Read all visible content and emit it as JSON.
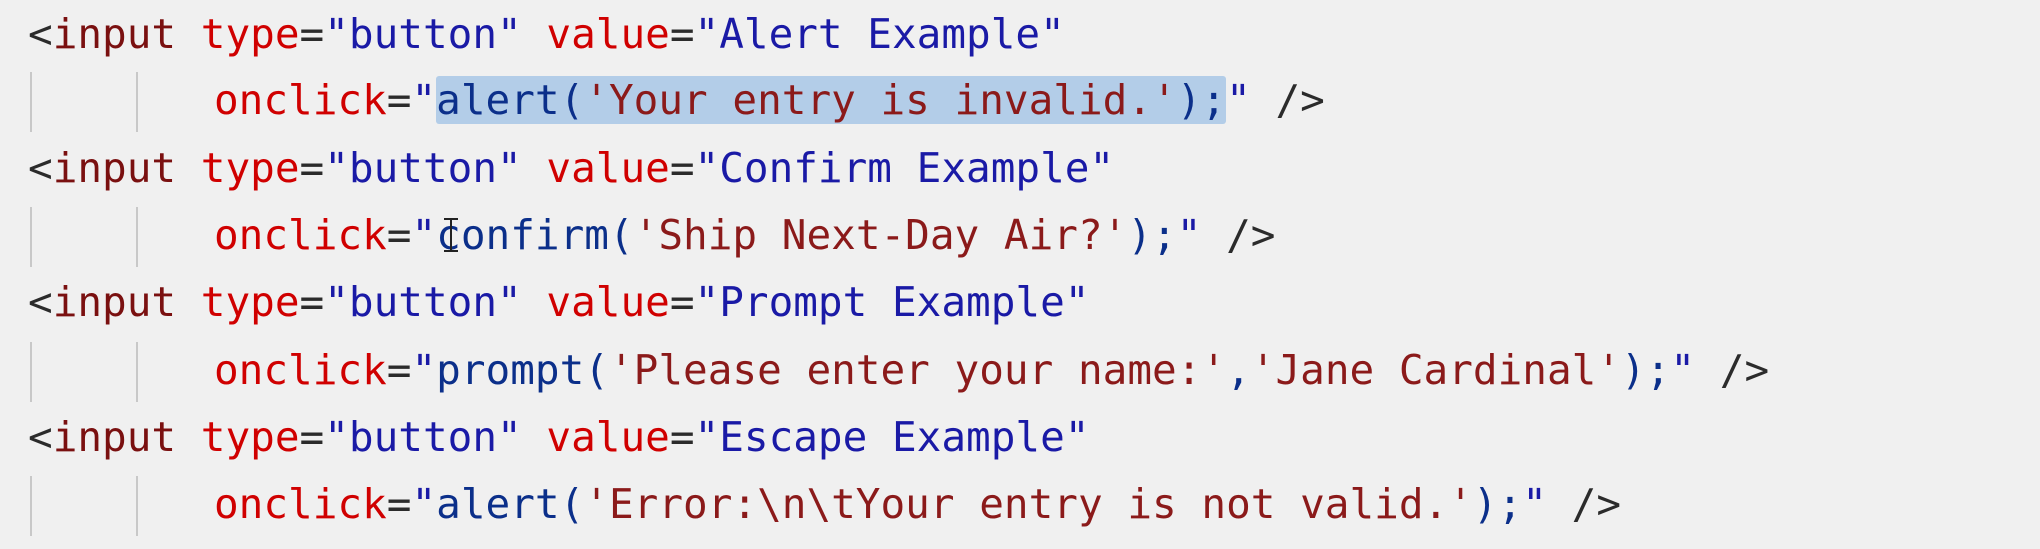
{
  "editor": {
    "lines": [
      {
        "open": "<",
        "tag": "input",
        "type_attr": "type",
        "eq1": "=",
        "type_val": "\"button\"",
        "value_attr": "value",
        "eq2": "=",
        "value_val": "\"Alert Example\""
      },
      {
        "onclick_attr": "onclick",
        "eq": "=",
        "quote_open": "\"",
        "js_fn": "alert(",
        "js_str": "'Your entry is invalid.'",
        "js_end": ");",
        "quote_close": "\"",
        "close": " />"
      },
      {
        "open": "<",
        "tag": "input",
        "type_attr": "type",
        "eq1": "=",
        "type_val": "\"button\"",
        "value_attr": "value",
        "eq2": "=",
        "value_val": "\"Confirm Example\""
      },
      {
        "onclick_attr": "onclick",
        "eq": "=",
        "quote_open": "\"",
        "js_fn": "confirm(",
        "js_str": "'Ship Next-Day Air?'",
        "js_end": ");",
        "quote_close": "\"",
        "close": " />"
      },
      {
        "open": "<",
        "tag": "input",
        "type_attr": "type",
        "eq1": "=",
        "type_val": "\"button\"",
        "value_attr": "value",
        "eq2": "=",
        "value_val": "\"Prompt Example\""
      },
      {
        "onclick_attr": "onclick",
        "eq": "=",
        "quote_open": "\"",
        "js_fn": "prompt(",
        "js_str": "'Please enter your name:'",
        "js_comma": ",",
        "js_str2": "'Jane Cardinal'",
        "js_end": ");",
        "quote_close": "\"",
        "close": " />"
      },
      {
        "open": "<",
        "tag": "input",
        "type_attr": "type",
        "eq1": "=",
        "type_val": "\"button\"",
        "value_attr": "value",
        "eq2": "=",
        "value_val": "\"Escape Example\""
      },
      {
        "onclick_attr": "onclick",
        "eq": "=",
        "quote_open": "\"",
        "js_fn": "alert(",
        "js_str": "'Error:\\n\\tYour entry is not valid.'",
        "js_end": ");",
        "quote_close": "\"",
        "close": " />"
      }
    ],
    "selection_color": "#b3cde8",
    "background_color": "#f0f0f0"
  }
}
